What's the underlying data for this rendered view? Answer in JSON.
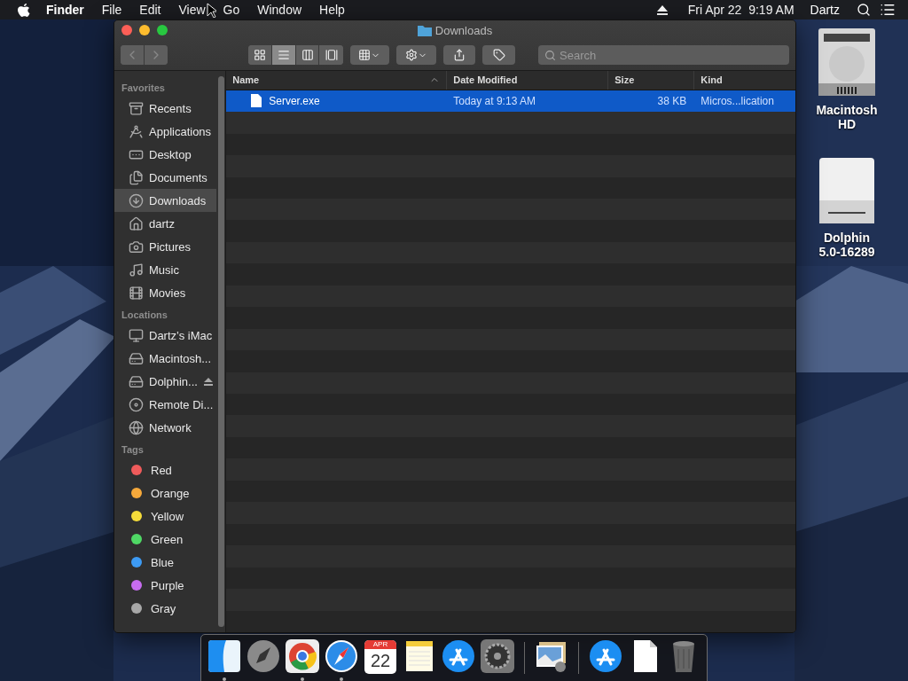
{
  "menu_bar": {
    "menus": [
      {
        "label": "Finder",
        "bold": true
      },
      {
        "label": "File",
        "bold": false
      },
      {
        "label": "Edit",
        "bold": false
      },
      {
        "label": "View",
        "bold": false
      },
      {
        "label": "Go",
        "bold": false
      },
      {
        "label": "Window",
        "bold": false
      },
      {
        "label": "Help",
        "bold": false
      }
    ],
    "clock": "Fri Apr 22  9:19 AM",
    "user": "Dartz"
  },
  "window": {
    "title": "Downloads",
    "view_modes": [
      {
        "selected": false
      },
      {
        "selected": true
      },
      {
        "selected": false
      },
      {
        "selected": false
      }
    ],
    "search": {
      "placeholder": "Search"
    }
  },
  "sidebar": {
    "sections": [
      {
        "heading": "Favorites",
        "items": [
          {
            "label": "Recents",
            "selected": false
          },
          {
            "label": "Applications",
            "selected": false
          },
          {
            "label": "Desktop",
            "selected": false
          },
          {
            "label": "Documents",
            "selected": false
          },
          {
            "label": "Downloads",
            "selected": true
          },
          {
            "label": "dartz",
            "selected": false
          },
          {
            "label": "Pictures",
            "selected": false
          },
          {
            "label": "Music",
            "selected": false
          },
          {
            "label": "Movies",
            "selected": false
          }
        ]
      },
      {
        "heading": "Locations",
        "items": [
          {
            "label": "Dartz’s iMac",
            "selected": false,
            "ejectable": false
          },
          {
            "label": "Macintosh...",
            "selected": false,
            "ejectable": false
          },
          {
            "label": "Dolphin...",
            "selected": false,
            "ejectable": true
          },
          {
            "label": "Remote Di...",
            "selected": false,
            "ejectable": false
          },
          {
            "label": "Network",
            "selected": false,
            "ejectable": false
          }
        ]
      },
      {
        "heading": "Tags",
        "items": [
          {
            "label": "Red",
            "selected": false,
            "color": "#ef5b5b"
          },
          {
            "label": "Orange",
            "selected": false,
            "color": "#f6a93b"
          },
          {
            "label": "Yellow",
            "selected": false,
            "color": "#f5dc3a"
          },
          {
            "label": "Green",
            "selected": false,
            "color": "#4fd865"
          },
          {
            "label": "Blue",
            "selected": false,
            "color": "#3d9bf4"
          },
          {
            "label": "Purple",
            "selected": false,
            "color": "#c76cf0"
          },
          {
            "label": "Gray",
            "selected": false,
            "color": "#a8a8a8"
          }
        ]
      }
    ]
  },
  "table": {
    "columns": [
      {
        "label": "Name",
        "sorted": true
      },
      {
        "label": "Date Modified",
        "sorted": false
      },
      {
        "label": "Size",
        "sorted": false
      },
      {
        "label": "Kind",
        "sorted": false
      }
    ],
    "rows": [
      {
        "name": "Server.exe",
        "date": "Today at 9:13 AM",
        "size": "38 KB",
        "kind": "Micros...lication",
        "selected": true
      }
    ]
  },
  "desktop_icons": [
    {
      "label": "Macintosh HD"
    },
    {
      "label": "Dolphin 5.0-16289"
    }
  ],
  "dock": {
    "items": [
      {
        "running": true
      },
      {
        "running": false
      },
      {
        "running": true
      },
      {
        "running": true
      },
      {
        "running": false,
        "month": "APR",
        "day": "22"
      },
      {
        "running": false
      },
      {
        "running": false
      },
      {
        "running": false
      },
      {
        "running": false
      },
      {
        "running": false
      },
      {
        "running": false
      },
      {
        "running": false
      }
    ]
  }
}
